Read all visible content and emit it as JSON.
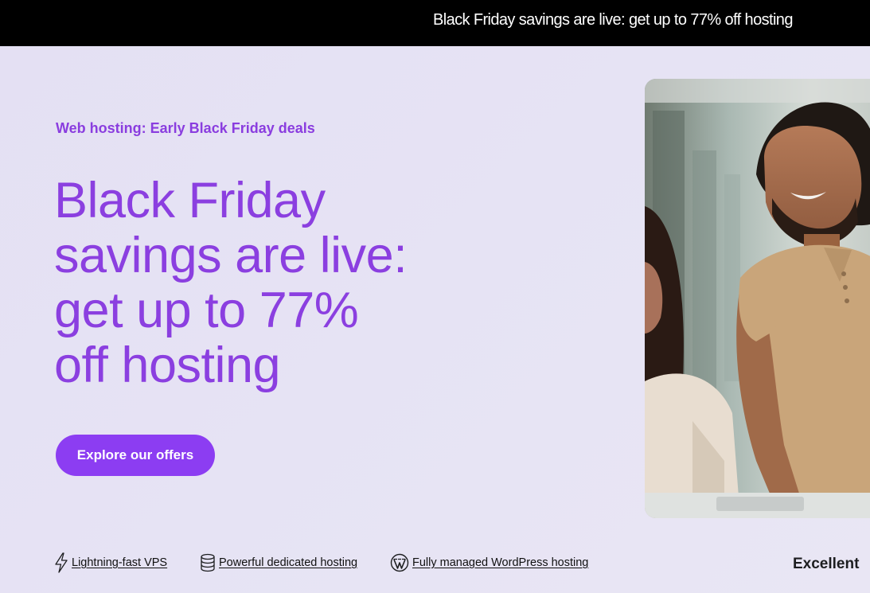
{
  "banner": {
    "text": "Black Friday savings are live: get up to 77% off hosting"
  },
  "hero": {
    "eyebrow": "Web hosting: Early Black Friday deals",
    "headline_lines": [
      "Black Friday",
      "savings are live:",
      "get up to 77%",
      "off hosting"
    ],
    "cta_label": "Explore our offers"
  },
  "features": [
    {
      "label": "Lightning-fast VPS",
      "icon": "lightning-icon"
    },
    {
      "label": "Powerful dedicated hosting",
      "icon": "database-icon"
    },
    {
      "label": "Fully managed WordPress hosting",
      "icon": "wordpress-icon"
    }
  ],
  "rating": {
    "label": "Excellent"
  },
  "colors": {
    "accent": "#8c3df2",
    "headline": "#8b3fe0",
    "banner_bg": "#000000",
    "page_bg": "#e6e3f4"
  }
}
